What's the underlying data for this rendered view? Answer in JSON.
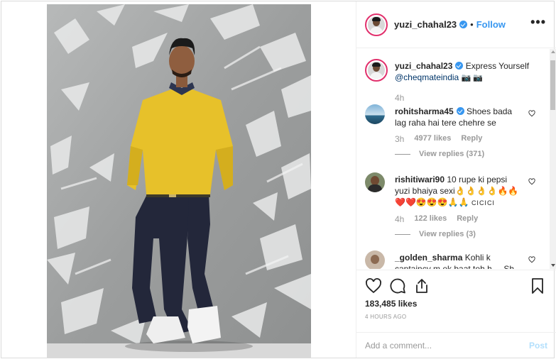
{
  "header": {
    "username": "yuzi_chahal23",
    "separator": "•",
    "follow_label": "Follow",
    "more_label": "•••"
  },
  "caption": {
    "username": "yuzi_chahal23",
    "text": "Express Yourself",
    "mention": "@cheqmateindia",
    "emoji": "📷 📷",
    "time": "4h"
  },
  "comments": [
    {
      "username": "rohitsharma45",
      "verified": true,
      "text": "Shoes bada lag raha hai tere chehre se",
      "time": "3h",
      "likes": "4977 likes",
      "reply_label": "Reply",
      "view_replies": "View replies (371)"
    },
    {
      "username": "rishitiwari90",
      "verified": false,
      "text": "10 rupe ki pepsi yuzi bhaiya sexi👌👌👌👌🔥🔥❤️❤️😍😍😍🙏🙏",
      "suffix": "cicici",
      "time": "4h",
      "likes": "122 likes",
      "reply_label": "Reply",
      "view_replies": "View replies (3)"
    },
    {
      "username": "_golden_sharma",
      "verified": false,
      "text": "Kohli k captaincy m ek baat toh h ... Sh"
    }
  ],
  "actions": {
    "likes_count": "183,485 likes",
    "time_ago": "4 HOURS AGO",
    "comment_placeholder": "Add a comment...",
    "post_label": "Post",
    "icons": [
      "heart-icon",
      "comment-icon",
      "share-icon",
      "bookmark-icon"
    ]
  },
  "colors": {
    "link": "#3897f0",
    "mention": "#003569",
    "muted": "#999999",
    "post_disabled": "#b2dffc",
    "border": "#dbdbdb"
  }
}
